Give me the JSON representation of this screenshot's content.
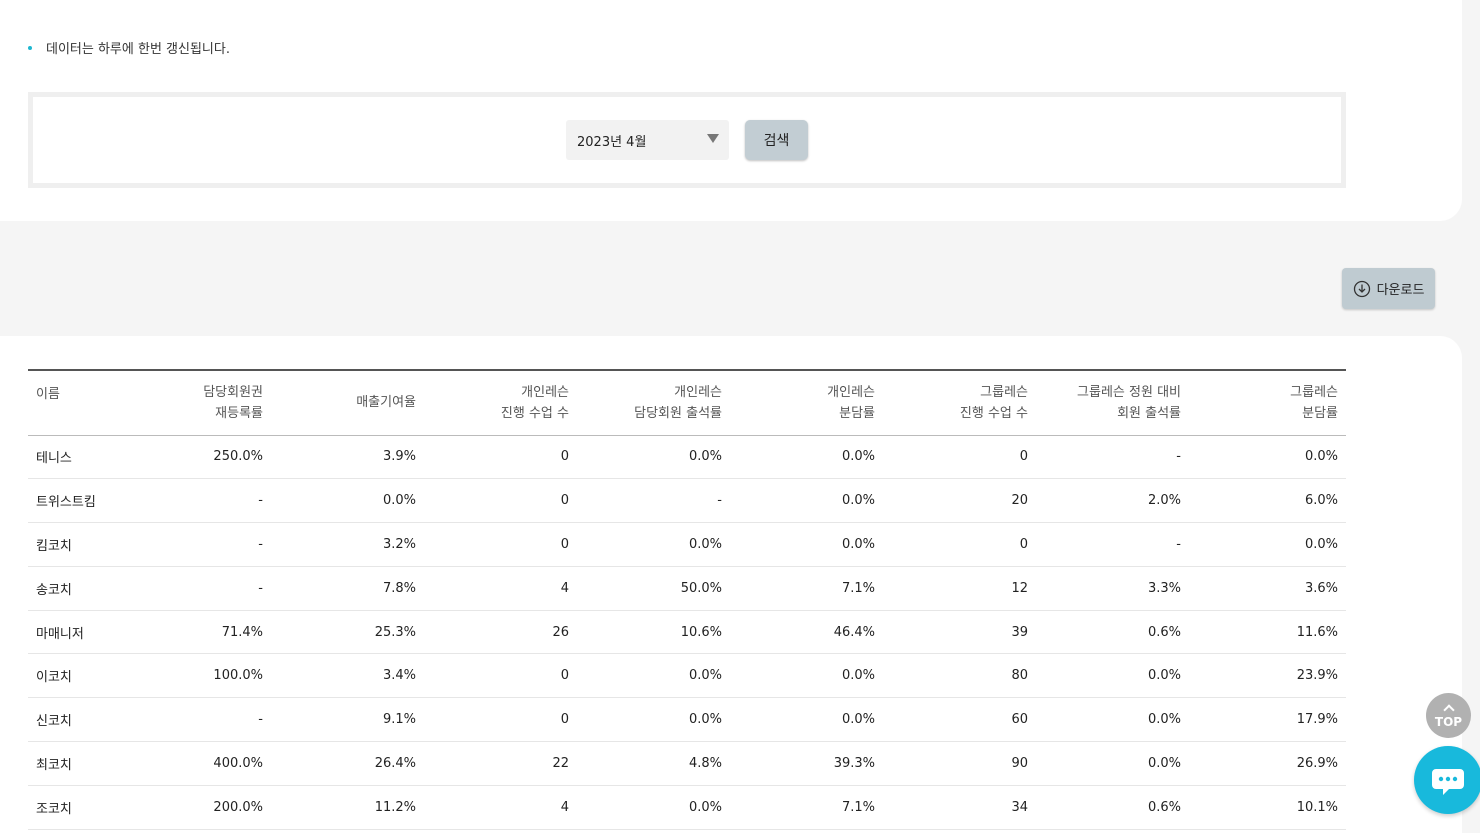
{
  "notice": {
    "text": "데이터는 하루에 한번 갱신됩니다."
  },
  "search": {
    "selected_month": "2023년 4월",
    "search_label": "검색"
  },
  "toolbar": {
    "download_label": "다운로드"
  },
  "table": {
    "headers": [
      [
        "이름",
        ""
      ],
      [
        "담당회원권",
        "재등록률"
      ],
      [
        "매출기여율",
        ""
      ],
      [
        "개인레슨",
        "진행 수업 수"
      ],
      [
        "개인레슨",
        "담당회원 출석률"
      ],
      [
        "개인레슨",
        "분담률"
      ],
      [
        "그룹레슨",
        "진행 수업 수"
      ],
      [
        "그룹레슨 정원 대비",
        "회원 출석률"
      ],
      [
        "그룹레슨",
        "분담률"
      ]
    ],
    "rows": [
      [
        "테니스",
        "250.0%",
        "3.9%",
        "0",
        "0.0%",
        "0.0%",
        "0",
        "-",
        "0.0%"
      ],
      [
        "트위스트킴",
        "-",
        "0.0%",
        "0",
        "-",
        "0.0%",
        "20",
        "2.0%",
        "6.0%"
      ],
      [
        "킴코치",
        "-",
        "3.2%",
        "0",
        "0.0%",
        "0.0%",
        "0",
        "-",
        "0.0%"
      ],
      [
        "송코치",
        "-",
        "7.8%",
        "4",
        "50.0%",
        "7.1%",
        "12",
        "3.3%",
        "3.6%"
      ],
      [
        "마매니저",
        "71.4%",
        "25.3%",
        "26",
        "10.6%",
        "46.4%",
        "39",
        "0.6%",
        "11.6%"
      ],
      [
        "이코치",
        "100.0%",
        "3.4%",
        "0",
        "0.0%",
        "0.0%",
        "80",
        "0.0%",
        "23.9%"
      ],
      [
        "신코치",
        "-",
        "9.1%",
        "0",
        "0.0%",
        "0.0%",
        "60",
        "0.0%",
        "17.9%"
      ],
      [
        "최코치",
        "400.0%",
        "26.4%",
        "22",
        "4.8%",
        "39.3%",
        "90",
        "0.0%",
        "26.9%"
      ],
      [
        "조코치",
        "200.0%",
        "11.2%",
        "4",
        "0.0%",
        "7.1%",
        "34",
        "0.6%",
        "10.1%"
      ]
    ]
  },
  "floating": {
    "top_label": "TOP"
  },
  "icons": {
    "download": "download-circle-icon",
    "top": "chevron-up-icon",
    "chat": "chat-bubble-icon"
  },
  "colors": {
    "accent": "#18b9dc",
    "button_bg": "#c2cdd3"
  }
}
